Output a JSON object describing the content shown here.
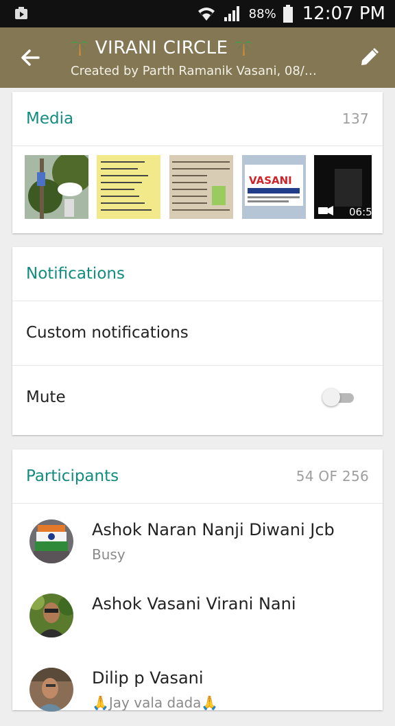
{
  "status_bar": {
    "battery_percent": "88%",
    "time": "12:07 PM",
    "icons": [
      "notification-icon",
      "wifi-icon",
      "signal-icon",
      "battery-icon"
    ]
  },
  "app_bar": {
    "title": "VIRANI CIRCLE",
    "title_emoji": "palm-tree-icon",
    "subtitle": "Created by Parth Ramanik Vasani, 08/…"
  },
  "media": {
    "header": "Media",
    "count": "137",
    "video_duration": "06:5"
  },
  "notifications": {
    "header": "Notifications",
    "custom_label": "Custom notifications",
    "mute_label": "Mute",
    "mute_on": false
  },
  "participants": {
    "header": "Participants",
    "count": "54 OF 256",
    "list": [
      {
        "name": "Ashok Naran Nanji Diwani Jcb",
        "status": "Busy"
      },
      {
        "name": "Ashok Vasani Virani Nani",
        "status": ""
      },
      {
        "name": "Dilip p Vasani",
        "status": "🙏Jay vala dada🙏"
      }
    ]
  },
  "colors": {
    "app_bar": "#847753",
    "accent": "#128c7e",
    "status_bar": "#111111"
  }
}
